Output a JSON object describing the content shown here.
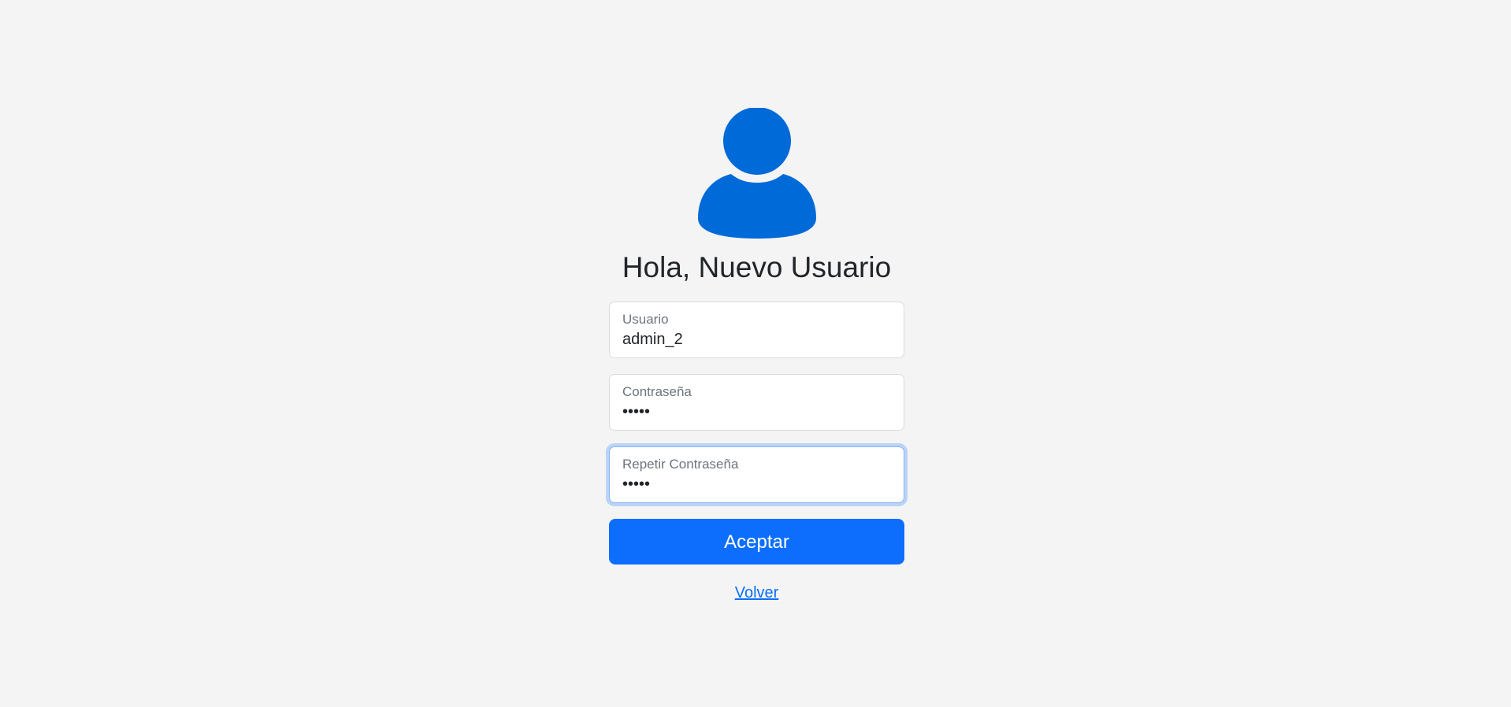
{
  "header": {
    "greeting": "Hola, Nuevo Usuario",
    "avatar_icon": "user-icon"
  },
  "form": {
    "username": {
      "label": "Usuario",
      "value": "admin_2"
    },
    "password": {
      "label": "Contraseña",
      "value": "•••••"
    },
    "repeat_password": {
      "label": "Repetir Contraseña",
      "value": "•••••",
      "focused": true
    },
    "submit_label": "Aceptar",
    "back_link": "Volver"
  },
  "colors": {
    "accent": "#0d6efd",
    "avatar": "#006ad8",
    "background": "#f4f4f4"
  }
}
